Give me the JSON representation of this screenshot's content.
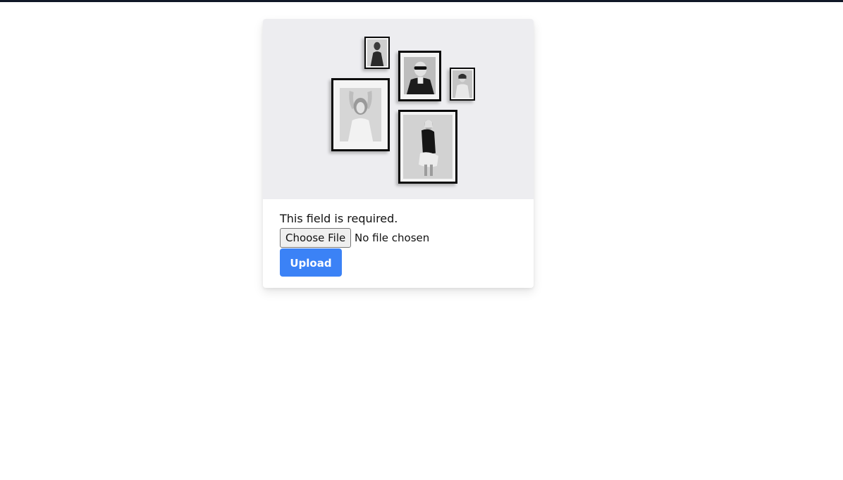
{
  "form": {
    "error_message": "This field is required.",
    "file_input": {
      "button_label": "Choose File",
      "status_text": "No file chosen"
    },
    "submit_label": "Upload"
  },
  "colors": {
    "accent": "#3b82f6",
    "hero_background": "#ededf0",
    "top_bar": "#111827"
  }
}
